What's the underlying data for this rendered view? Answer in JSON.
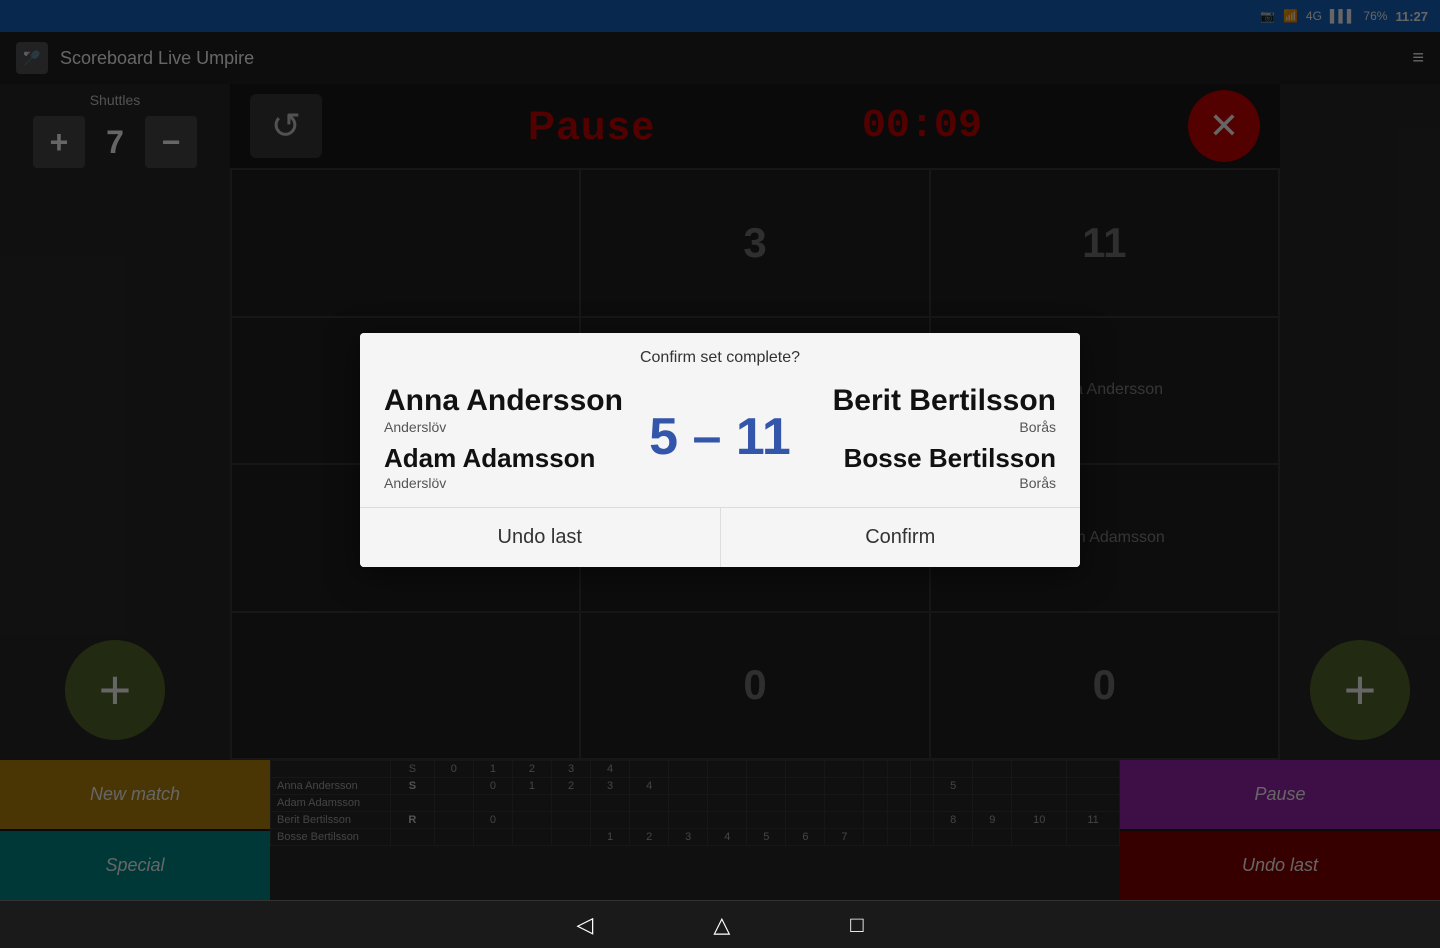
{
  "statusBar": {
    "time": "11:27",
    "battery": "76%",
    "signal": "4G"
  },
  "appBar": {
    "title": "Scoreboard Live Umpire",
    "settingsIcon": "≡"
  },
  "shuttles": {
    "label": "Shuttles",
    "value": "7",
    "addLabel": "+",
    "minusLabel": "−"
  },
  "topControls": {
    "swapIcon": "↺",
    "pauseLabel": "Pause",
    "timerValue": "00:09",
    "closeIcon": "✕"
  },
  "scoreGrid": {
    "leftScore": "3",
    "rightScore": "11",
    "leftPlayer1": "Berit Bertilsson",
    "rightPlayer1": "Anna Andersson",
    "leftCurrentScore": "0",
    "rightCurrentScore": "0"
  },
  "leftTeam": {
    "player1": "Bosse Bertilsson",
    "player2": "Berit Bertilsson"
  },
  "rightTeam": {
    "player1": "Anna Andersson",
    "player2": "Adam Adamsson"
  },
  "bottomBar": {
    "newMatchLabel": "New match",
    "specialLabel": "Special",
    "pauseLabel": "Pause",
    "undoLastLabel": "Undo last"
  },
  "scoreTable": {
    "columns": [
      "",
      "S",
      "0",
      "1",
      "2",
      "3",
      "4",
      "",
      "",
      "",
      "",
      "",
      "",
      "",
      "",
      "",
      "",
      "",
      "",
      "",
      ""
    ],
    "rows": [
      {
        "player": "Anna Andersson",
        "s": "S",
        "scores": [
          "",
          "0",
          "1",
          "2",
          "3",
          "4",
          "",
          "",
          "",
          "",
          "",
          "",
          "",
          "",
          "5",
          "",
          "",
          "",
          "",
          "",
          ""
        ]
      },
      {
        "player": "Adam Adamsson",
        "s": "",
        "scores": [
          "",
          "",
          "",
          "",
          "",
          "",
          "",
          "",
          "",
          "",
          "",
          "",
          "",
          "",
          "",
          "",
          "",
          "",
          "",
          "",
          ""
        ]
      },
      {
        "player": "Berit Bertilsson",
        "s": "R",
        "scores": [
          "",
          "0",
          "",
          "",
          "",
          "",
          "",
          "",
          "",
          "",
          "",
          "",
          "",
          "",
          "8",
          "9",
          "10",
          "11",
          "",
          "",
          ""
        ]
      },
      {
        "player": "Bosse Bertilsson",
        "s": "",
        "scores": [
          "",
          "",
          "",
          "",
          "1",
          "2",
          "3",
          "4",
          "5",
          "6",
          "7",
          "",
          "",
          "",
          "",
          "",
          "",
          "",
          "",
          "",
          ""
        ]
      }
    ]
  },
  "modal": {
    "headerText": "Confirm set complete?",
    "leftPlayer1": "Anna Andersson",
    "leftCity1": "Anderslöv",
    "leftPlayer2": "Adam Adamsson",
    "leftCity2": "Anderslöv",
    "scoreText": "5 – 11",
    "rightPlayer1": "Berit Bertilsson",
    "rightCity1": "Borås",
    "rightPlayer2": "Bosse Bertilsson",
    "rightCity2": "Borås",
    "undoLastLabel": "Undo last",
    "confirmLabel": "Confirm"
  },
  "navBar": {
    "backIcon": "◁",
    "homeIcon": "△",
    "squareIcon": "□"
  }
}
